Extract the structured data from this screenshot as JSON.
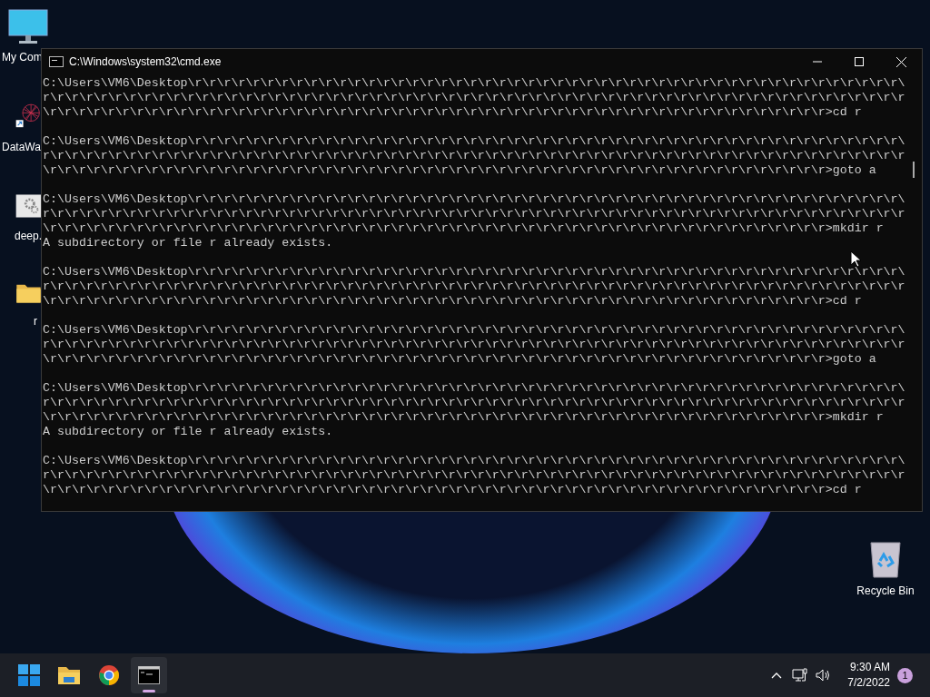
{
  "desktop_icons": [
    {
      "label": "My Com",
      "kind": "computer"
    },
    {
      "label": "DataWa",
      "kind": "shortcut"
    },
    {
      "label": "deep.",
      "kind": "settings"
    },
    {
      "label": "r",
      "kind": "folder"
    }
  ],
  "recycle_bin": {
    "label": "Recycle Bin"
  },
  "window": {
    "title": "C:\\Windows\\system32\\cmd.exe",
    "blocks": [
      {
        "lines": [
          "C:\\Users\\VM6\\Desktop\\r\\r\\r\\r\\r\\r\\r\\r\\r\\r\\r\\r\\r\\r\\r\\r\\r\\r\\r\\r\\r\\r\\r\\r\\r\\r\\r\\r\\r\\r\\r\\r\\r\\r\\r\\r\\r\\r\\r\\r\\r\\r\\r\\r\\r\\r\\r\\r\\r\\",
          "r\\r\\r\\r\\r\\r\\r\\r\\r\\r\\r\\r\\r\\r\\r\\r\\r\\r\\r\\r\\r\\r\\r\\r\\r\\r\\r\\r\\r\\r\\r\\r\\r\\r\\r\\r\\r\\r\\r\\r\\r\\r\\r\\r\\r\\r\\r\\r\\r\\r\\r\\r\\r\\r\\r\\r\\r\\r\\r\\r",
          "\\r\\r\\r\\r\\r\\r\\r\\r\\r\\r\\r\\r\\r\\r\\r\\r\\r\\r\\r\\r\\r\\r\\r\\r\\r\\r\\r\\r\\r\\r\\r\\r\\r\\r\\r\\r\\r\\r\\r\\r\\r\\r\\r\\r\\r\\r\\r\\r\\r\\r\\r\\r\\r\\r>cd r"
        ]
      },
      {
        "lines": [
          "C:\\Users\\VM6\\Desktop\\r\\r\\r\\r\\r\\r\\r\\r\\r\\r\\r\\r\\r\\r\\r\\r\\r\\r\\r\\r\\r\\r\\r\\r\\r\\r\\r\\r\\r\\r\\r\\r\\r\\r\\r\\r\\r\\r\\r\\r\\r\\r\\r\\r\\r\\r\\r\\r\\r\\",
          "r\\r\\r\\r\\r\\r\\r\\r\\r\\r\\r\\r\\r\\r\\r\\r\\r\\r\\r\\r\\r\\r\\r\\r\\r\\r\\r\\r\\r\\r\\r\\r\\r\\r\\r\\r\\r\\r\\r\\r\\r\\r\\r\\r\\r\\r\\r\\r\\r\\r\\r\\r\\r\\r\\r\\r\\r\\r\\r\\r",
          "\\r\\r\\r\\r\\r\\r\\r\\r\\r\\r\\r\\r\\r\\r\\r\\r\\r\\r\\r\\r\\r\\r\\r\\r\\r\\r\\r\\r\\r\\r\\r\\r\\r\\r\\r\\r\\r\\r\\r\\r\\r\\r\\r\\r\\r\\r\\r\\r\\r\\r\\r\\r\\r\\r>goto a"
        ]
      },
      {
        "lines": [
          "C:\\Users\\VM6\\Desktop\\r\\r\\r\\r\\r\\r\\r\\r\\r\\r\\r\\r\\r\\r\\r\\r\\r\\r\\r\\r\\r\\r\\r\\r\\r\\r\\r\\r\\r\\r\\r\\r\\r\\r\\r\\r\\r\\r\\r\\r\\r\\r\\r\\r\\r\\r\\r\\r\\r\\",
          "r\\r\\r\\r\\r\\r\\r\\r\\r\\r\\r\\r\\r\\r\\r\\r\\r\\r\\r\\r\\r\\r\\r\\r\\r\\r\\r\\r\\r\\r\\r\\r\\r\\r\\r\\r\\r\\r\\r\\r\\r\\r\\r\\r\\r\\r\\r\\r\\r\\r\\r\\r\\r\\r\\r\\r\\r\\r\\r\\r",
          "\\r\\r\\r\\r\\r\\r\\r\\r\\r\\r\\r\\r\\r\\r\\r\\r\\r\\r\\r\\r\\r\\r\\r\\r\\r\\r\\r\\r\\r\\r\\r\\r\\r\\r\\r\\r\\r\\r\\r\\r\\r\\r\\r\\r\\r\\r\\r\\r\\r\\r\\r\\r\\r\\r>mkdir r"
        ],
        "output": "A subdirectory or file r already exists."
      },
      {
        "lines": [
          "C:\\Users\\VM6\\Desktop\\r\\r\\r\\r\\r\\r\\r\\r\\r\\r\\r\\r\\r\\r\\r\\r\\r\\r\\r\\r\\r\\r\\r\\r\\r\\r\\r\\r\\r\\r\\r\\r\\r\\r\\r\\r\\r\\r\\r\\r\\r\\r\\r\\r\\r\\r\\r\\r\\r\\",
          "r\\r\\r\\r\\r\\r\\r\\r\\r\\r\\r\\r\\r\\r\\r\\r\\r\\r\\r\\r\\r\\r\\r\\r\\r\\r\\r\\r\\r\\r\\r\\r\\r\\r\\r\\r\\r\\r\\r\\r\\r\\r\\r\\r\\r\\r\\r\\r\\r\\r\\r\\r\\r\\r\\r\\r\\r\\r\\r\\r",
          "\\r\\r\\r\\r\\r\\r\\r\\r\\r\\r\\r\\r\\r\\r\\r\\r\\r\\r\\r\\r\\r\\r\\r\\r\\r\\r\\r\\r\\r\\r\\r\\r\\r\\r\\r\\r\\r\\r\\r\\r\\r\\r\\r\\r\\r\\r\\r\\r\\r\\r\\r\\r\\r\\r>cd r"
        ]
      },
      {
        "lines": [
          "C:\\Users\\VM6\\Desktop\\r\\r\\r\\r\\r\\r\\r\\r\\r\\r\\r\\r\\r\\r\\r\\r\\r\\r\\r\\r\\r\\r\\r\\r\\r\\r\\r\\r\\r\\r\\r\\r\\r\\r\\r\\r\\r\\r\\r\\r\\r\\r\\r\\r\\r\\r\\r\\r\\r\\",
          "r\\r\\r\\r\\r\\r\\r\\r\\r\\r\\r\\r\\r\\r\\r\\r\\r\\r\\r\\r\\r\\r\\r\\r\\r\\r\\r\\r\\r\\r\\r\\r\\r\\r\\r\\r\\r\\r\\r\\r\\r\\r\\r\\r\\r\\r\\r\\r\\r\\r\\r\\r\\r\\r\\r\\r\\r\\r\\r\\r",
          "\\r\\r\\r\\r\\r\\r\\r\\r\\r\\r\\r\\r\\r\\r\\r\\r\\r\\r\\r\\r\\r\\r\\r\\r\\r\\r\\r\\r\\r\\r\\r\\r\\r\\r\\r\\r\\r\\r\\r\\r\\r\\r\\r\\r\\r\\r\\r\\r\\r\\r\\r\\r\\r\\r>goto a"
        ]
      },
      {
        "lines": [
          "C:\\Users\\VM6\\Desktop\\r\\r\\r\\r\\r\\r\\r\\r\\r\\r\\r\\r\\r\\r\\r\\r\\r\\r\\r\\r\\r\\r\\r\\r\\r\\r\\r\\r\\r\\r\\r\\r\\r\\r\\r\\r\\r\\r\\r\\r\\r\\r\\r\\r\\r\\r\\r\\r\\r\\",
          "r\\r\\r\\r\\r\\r\\r\\r\\r\\r\\r\\r\\r\\r\\r\\r\\r\\r\\r\\r\\r\\r\\r\\r\\r\\r\\r\\r\\r\\r\\r\\r\\r\\r\\r\\r\\r\\r\\r\\r\\r\\r\\r\\r\\r\\r\\r\\r\\r\\r\\r\\r\\r\\r\\r\\r\\r\\r\\r\\r",
          "\\r\\r\\r\\r\\r\\r\\r\\r\\r\\r\\r\\r\\r\\r\\r\\r\\r\\r\\r\\r\\r\\r\\r\\r\\r\\r\\r\\r\\r\\r\\r\\r\\r\\r\\r\\r\\r\\r\\r\\r\\r\\r\\r\\r\\r\\r\\r\\r\\r\\r\\r\\r\\r\\r>mkdir r"
        ],
        "output": "A subdirectory or file r already exists."
      },
      {
        "lines": [
          "C:\\Users\\VM6\\Desktop\\r\\r\\r\\r\\r\\r\\r\\r\\r\\r\\r\\r\\r\\r\\r\\r\\r\\r\\r\\r\\r\\r\\r\\r\\r\\r\\r\\r\\r\\r\\r\\r\\r\\r\\r\\r\\r\\r\\r\\r\\r\\r\\r\\r\\r\\r\\r\\r\\r\\",
          "r\\r\\r\\r\\r\\r\\r\\r\\r\\r\\r\\r\\r\\r\\r\\r\\r\\r\\r\\r\\r\\r\\r\\r\\r\\r\\r\\r\\r\\r\\r\\r\\r\\r\\r\\r\\r\\r\\r\\r\\r\\r\\r\\r\\r\\r\\r\\r\\r\\r\\r\\r\\r\\r\\r\\r\\r\\r\\r\\r",
          "\\r\\r\\r\\r\\r\\r\\r\\r\\r\\r\\r\\r\\r\\r\\r\\r\\r\\r\\r\\r\\r\\r\\r\\r\\r\\r\\r\\r\\r\\r\\r\\r\\r\\r\\r\\r\\r\\r\\r\\r\\r\\r\\r\\r\\r\\r\\r\\r\\r\\r\\r\\r\\r\\r>cd r"
        ]
      }
    ]
  },
  "taskbar": {
    "apps": [
      {
        "kind": "start",
        "selected": false
      },
      {
        "kind": "explorer",
        "selected": false
      },
      {
        "kind": "chrome",
        "selected": false
      },
      {
        "kind": "terminal",
        "selected": true
      }
    ],
    "time": "9:30 AM",
    "date": "7/2/2022",
    "notifications": "1"
  }
}
